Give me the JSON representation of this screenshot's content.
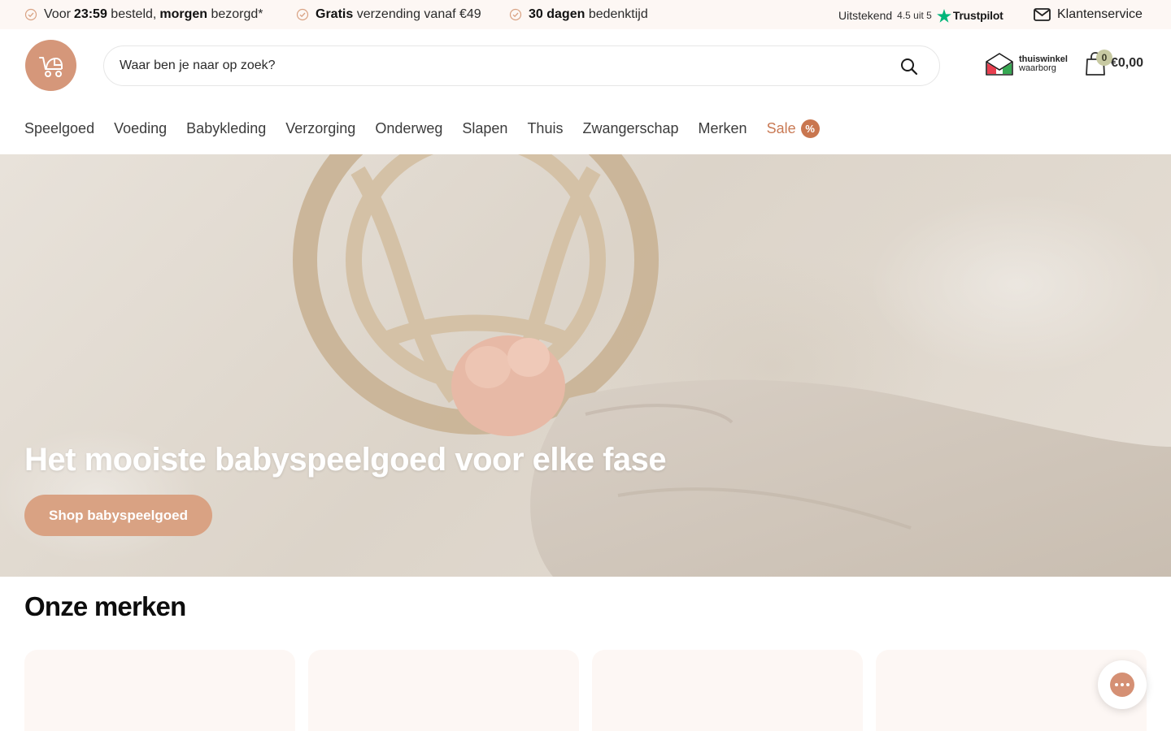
{
  "topbar": {
    "usp1": {
      "part1": "Voor",
      "time": "23:59",
      "part2": "besteld,",
      "bold2": "morgen",
      "part3": "bezorgd*"
    },
    "usp2": {
      "bold": "Gratis",
      "text": "verzending vanaf €49"
    },
    "usp3": {
      "bold": "30 dagen",
      "text": "bedenktijd"
    },
    "trustpilot": {
      "rating_label": "Uitstekend",
      "score": "4.5 uit 5",
      "brand": "Trustpilot"
    },
    "service_label": "Klantenservice"
  },
  "header": {
    "search_placeholder": "Waar ben je naar op zoek?",
    "thuiswinkel": {
      "line1": "thuiswinkel",
      "line2": "waarborg"
    },
    "cart": {
      "count": "0",
      "total": "€0,00"
    }
  },
  "nav": {
    "items": [
      "Speelgoed",
      "Voeding",
      "Babykleding",
      "Verzorging",
      "Onderweg",
      "Slapen",
      "Thuis",
      "Zwangerschap",
      "Merken"
    ],
    "sale_label": "Sale",
    "sale_badge": "%"
  },
  "hero": {
    "title": "Het mooiste babyspeelgoed voor elke fase",
    "cta": "Shop babyspeelgoed"
  },
  "brands": {
    "title": "Onze merken"
  },
  "colors": {
    "accent": "#d5977a",
    "sale": "#c97a55",
    "topbar_bg": "#fdf7f4",
    "card_bg": "#fdf7f4"
  },
  "icons": [
    "check-circle-icon",
    "trustpilot-star-icon",
    "mail-icon",
    "stroller-icon",
    "search-icon",
    "thuiswinkel-house-icon",
    "shopping-bag-icon",
    "chat-icon"
  ]
}
